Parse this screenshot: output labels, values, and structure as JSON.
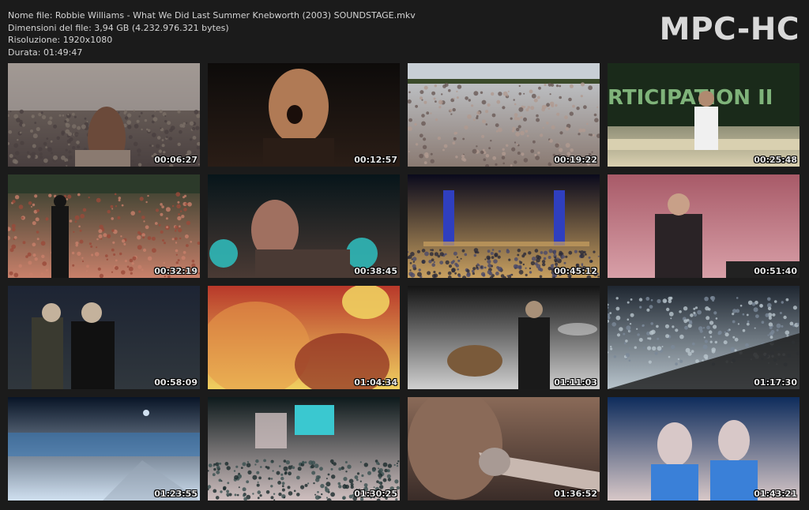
{
  "file_info": {
    "name_line": "Nome file: Robbie Williams - What We Did Last Summer Knebworth (2003) SOUNDSTAGE.mkv",
    "size_line": "Dimensioni del file: 3,94 GB (4.232.976.321 bytes)",
    "resolution_line": "Risoluzione: 1920x1080",
    "duration_line": "Durata: 01:49:47"
  },
  "brand": {
    "logo_text": "MPC-HC"
  },
  "colors": {
    "background": "#1b1b1b",
    "text": "#d4d4d4",
    "logo": "#d9d9d9"
  },
  "thumbnails": [
    {
      "timestamp": "00:06:27",
      "scene": "stage-crowd-front",
      "palette": [
        "#7a6f66",
        "#c9c3c1",
        "#4a4040"
      ]
    },
    {
      "timestamp": "00:12:57",
      "scene": "singer-closeup-dark",
      "palette": [
        "#0d0b0a",
        "#b07a55",
        "#2a1d16"
      ]
    },
    {
      "timestamp": "00:19:22",
      "scene": "crowd-wide-day",
      "palette": [
        "#c8cfd5",
        "#5a4e4a",
        "#8a7a72"
      ]
    },
    {
      "timestamp": "00:25:48",
      "scene": "participation-sign",
      "palette": [
        "#1e2a1e",
        "#7fb37a",
        "#d9d0b0"
      ],
      "sign_text": "RTICIPATION II"
    },
    {
      "timestamp": "00:32:19",
      "scene": "crowd-dense-day",
      "palette": [
        "#2c3a2a",
        "#9a4a3a",
        "#c8806a"
      ]
    },
    {
      "timestamp": "00:38:45",
      "scene": "singer-mic-teal",
      "palette": [
        "#07151a",
        "#2fb8b8",
        "#4a3a34"
      ]
    },
    {
      "timestamp": "00:45:12",
      "scene": "stage-blue-towers",
      "palette": [
        "#0a0a1c",
        "#2f3fbf",
        "#c8a060"
      ]
    },
    {
      "timestamp": "00:51:40",
      "scene": "singer-pink-screen",
      "palette": [
        "#a85a68",
        "#2a2326",
        "#d8a0a8"
      ]
    },
    {
      "timestamp": "00:58:09",
      "scene": "two-performers-dark",
      "palette": [
        "#1d2433",
        "#c4b29c",
        "#30373d"
      ]
    },
    {
      "timestamp": "01:04:34",
      "scene": "blurred-red-orange",
      "palette": [
        "#b8382a",
        "#e69a4a",
        "#f0d060"
      ]
    },
    {
      "timestamp": "01:11:03",
      "scene": "drummer-stage",
      "palette": [
        "#141414",
        "#a89078",
        "#cfcfcf"
      ]
    },
    {
      "timestamp": "01:17:30",
      "scene": "crowd-aerial-night",
      "palette": [
        "#1e2630",
        "#7a8898",
        "#b8c4cc"
      ]
    },
    {
      "timestamp": "01:23:55",
      "scene": "night-blue-wide",
      "palette": [
        "#081426",
        "#3a7ab8",
        "#d0e0f0"
      ]
    },
    {
      "timestamp": "01:30:25",
      "scene": "stage-screen-cyan",
      "palette": [
        "#0e1a1c",
        "#3ac8d0",
        "#d0c0c0"
      ]
    },
    {
      "timestamp": "01:36:52",
      "scene": "trumpet-closeup",
      "palette": [
        "#8a6a58",
        "#c8b8b0",
        "#3a2c28"
      ]
    },
    {
      "timestamp": "01:43:21",
      "scene": "crowd-girls-blue",
      "palette": [
        "#0e2c5c",
        "#3a80d8",
        "#d8c8c8"
      ]
    }
  ]
}
